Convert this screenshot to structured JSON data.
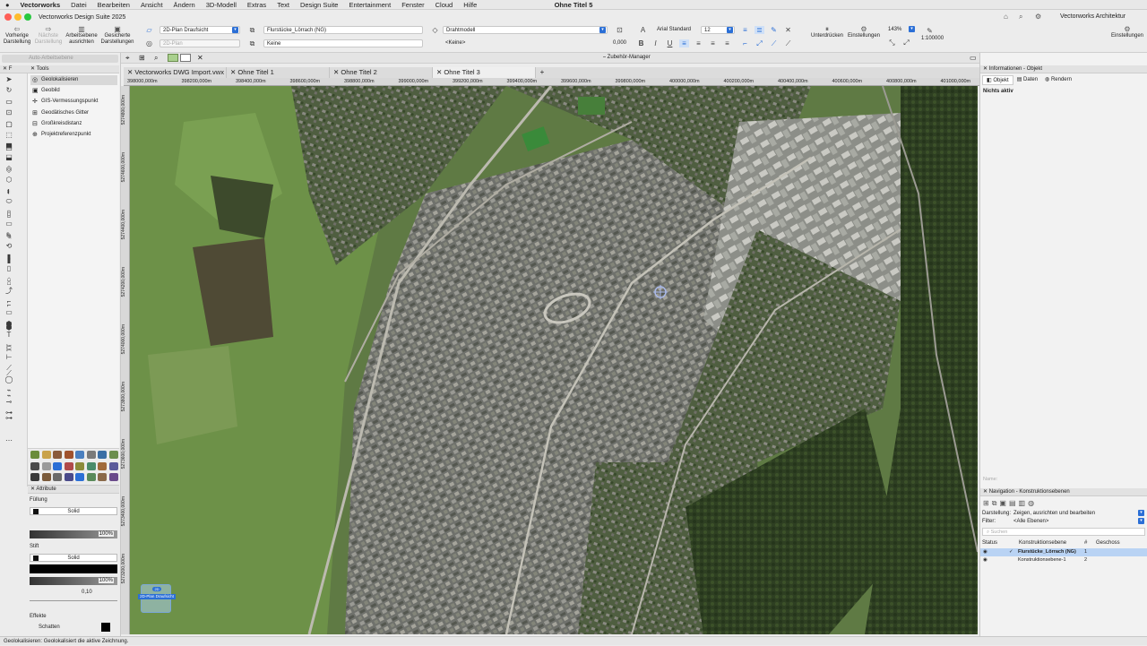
{
  "menu": {
    "apple": "",
    "items": [
      "Vectorworks",
      "Datei",
      "Bearbeiten",
      "Ansicht",
      "Ändern",
      "3D-Modell",
      "Extras",
      "Text",
      "Design Suite",
      "Entertainment",
      "Fenster",
      "Cloud",
      "Hilfe"
    ],
    "clock": "Ohne Titel 5"
  },
  "window": {
    "app_title": "Vectorworks Design Suite 2025",
    "workspace": "Vectorworks Architektur"
  },
  "toolbar": {
    "prev_view": "Vorherige Darstellung",
    "next_view": "Nächste Darstellung",
    "align_layer": "Arbeitsebene ausrichten",
    "saved_views": "Gesicherte Darstellungen",
    "view_select": "2D-Plan Draufsicht",
    "view_select2": "2D-Plan",
    "layer_select": "Flurstücke_Lörrach (NG)",
    "class_select": "Keine",
    "render_select": "Drahtmodell",
    "render_sub": "<Keine>",
    "offset": "0,000",
    "font": "Arial Standard",
    "font_size": "12",
    "suspend": "Unterdrücken",
    "settings": "Einstellungen",
    "zoom": "143%",
    "scale": "1:100000",
    "right_settings": "Einstellungen",
    "accessory_manager": "Zubehör-Manager"
  },
  "tools_panel": {
    "title": "Tools",
    "section": "Geolokalisieren",
    "items": [
      "Geolokalisieren",
      "Geobild",
      "GIS-Vermessungspunkt",
      "Geodätisches Gitter",
      "Großkreisdistanz",
      "Projektreferenzpunkt"
    ],
    "construction_plane": "Auto-Arbeitsebene"
  },
  "attributes": {
    "title": "Attribute",
    "fill_label": "Füllung",
    "fill_type": "Solid",
    "fill_opacity": "100%",
    "pen_label": "Stift",
    "pen_type": "Solid",
    "pen_opacity": "100%",
    "line_weight": "0,10",
    "effects_label": "Effekte",
    "shadow_label": "Schatten"
  },
  "doc_tabs": [
    "Vectorworks DWG Import.vwx",
    "Ohne Titel 1",
    "Ohne Titel 2",
    "Ohne Titel 3"
  ],
  "ruler_labels": [
    "398000,000m",
    "398200,000m",
    "398400,000m",
    "398600,000m",
    "398800,000m",
    "399000,000m",
    "399200,000m",
    "399400,000m",
    "399600,000m",
    "399800,000m",
    "400000,000m",
    "400200,000m",
    "400400,000m",
    "400600,000m",
    "400800,000m",
    "401000,000m"
  ],
  "vruler_labels": [
    "5274800,000m",
    "5274600,000m",
    "5274400,000m",
    "5274200,000m",
    "5274000,000m",
    "5273800,000m",
    "5273600,000m",
    "5273400,000m",
    "5273200,000m"
  ],
  "view_badge": {
    "top": "2D",
    "bottom": "2D-Plan Draufsicht"
  },
  "info_panel": {
    "title": "Informationen - Objekt",
    "tabs": [
      "Objekt",
      "Daten",
      "Rendern"
    ],
    "nothing_active": "Nichts aktiv",
    "name_label": "Name:"
  },
  "nav_panel": {
    "title": "Navigation - Konstruktionsebenen",
    "display_label": "Darstellung:",
    "display_value": "Zeigen, ausrichten und bearbeiten",
    "filter_label": "Filter:",
    "filter_value": "<Alle Ebenen>",
    "search_placeholder": "Suchen",
    "col_status": "Status",
    "col_layer": "Konstruktionsebene",
    "col_num": "#",
    "col_floor": "Geschoss",
    "rows": [
      {
        "name": "Flurstücke_Lörrach (NG)",
        "num": "1",
        "active": true
      },
      {
        "name": "Konstruktionsebene-1",
        "num": "2",
        "active": false
      }
    ]
  },
  "status_bar": "Geolokalisieren:  Geolokalisiert die aktive Zeichnung.",
  "colors": {
    "accent": "#2b6fd6",
    "map_green": "#4e6b3a",
    "map_urban": "#6f716c"
  }
}
